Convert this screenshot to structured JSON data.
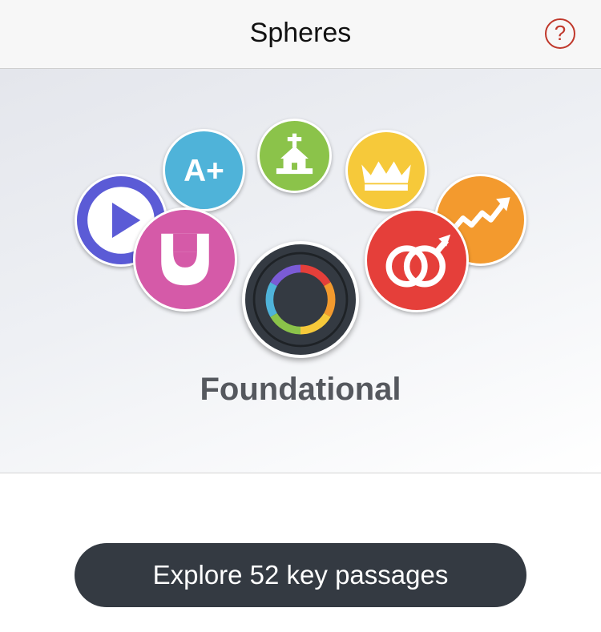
{
  "header": {
    "title": "Spheres",
    "help_icon": "question-circle-icon",
    "help_label": "?"
  },
  "spheres": {
    "items": [
      {
        "name": "video",
        "icon": "play-icon",
        "color": "#5b5bd6"
      },
      {
        "name": "education",
        "icon": "a-plus-icon",
        "color": "#4fb3d9"
      },
      {
        "name": "church",
        "icon": "church-icon",
        "color": "#8bc34a"
      },
      {
        "name": "government",
        "icon": "crown-icon",
        "color": "#f6c93a"
      },
      {
        "name": "economics",
        "icon": "trend-up-icon",
        "color": "#f39a2e"
      },
      {
        "name": "arts-media",
        "icon": "smile-icon",
        "color": "#d55aa8"
      },
      {
        "name": "family",
        "icon": "rings-icon",
        "color": "#e53f3a"
      },
      {
        "name": "foundational",
        "icon": "ring-icon",
        "color": "#343a42"
      }
    ],
    "selected_label": "Foundational",
    "a_plus_text": "A+"
  },
  "actions": {
    "explore_label": "Explore 52 key passages"
  }
}
